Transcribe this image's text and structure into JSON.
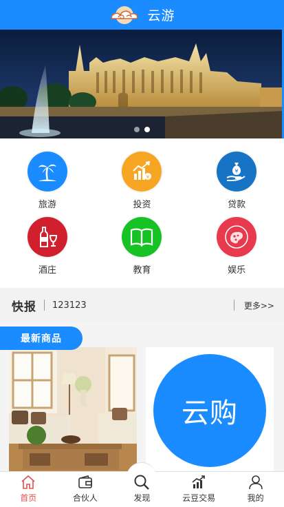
{
  "header": {
    "title": "云游",
    "logo_icon": "cloud-logo-icon",
    "bg_color": "#1a8cff"
  },
  "banner": {
    "slides": 2,
    "active_slide": 2
  },
  "categories": [
    {
      "label": "旅游",
      "icon": "palm-tree-icon",
      "color": "#1a8cff"
    },
    {
      "label": "投资",
      "icon": "chart-growth-icon",
      "color": "#f6a623"
    },
    {
      "label": "贷款",
      "icon": "money-bag-hand-icon",
      "color": "#1773c4"
    },
    {
      "label": "酒庄",
      "icon": "wine-bottle-glass-icon",
      "color": "#d0202e"
    },
    {
      "label": "教育",
      "icon": "open-book-icon",
      "color": "#16c224"
    },
    {
      "label": "娱乐",
      "icon": "game-icon",
      "color": "#e83a4e"
    }
  ],
  "news": {
    "label": "快报",
    "text": "123123",
    "more": "更多>>"
  },
  "products": {
    "section_title": "最新商品",
    "items": [
      {
        "image": "living-room-photo"
      },
      {
        "image": "yungou-logo",
        "logo_text": "云购"
      }
    ]
  },
  "tabbar": {
    "items": [
      {
        "label": "首页",
        "icon": "home-icon",
        "active": true
      },
      {
        "label": "合伙人",
        "icon": "wallet-icon",
        "active": false
      },
      {
        "label": "发现",
        "icon": "search-icon",
        "active": false
      },
      {
        "label": "云豆交易",
        "icon": "trend-chart-icon",
        "active": false
      },
      {
        "label": "我的",
        "icon": "user-icon",
        "active": false
      }
    ],
    "active_color": "#e0504d"
  }
}
